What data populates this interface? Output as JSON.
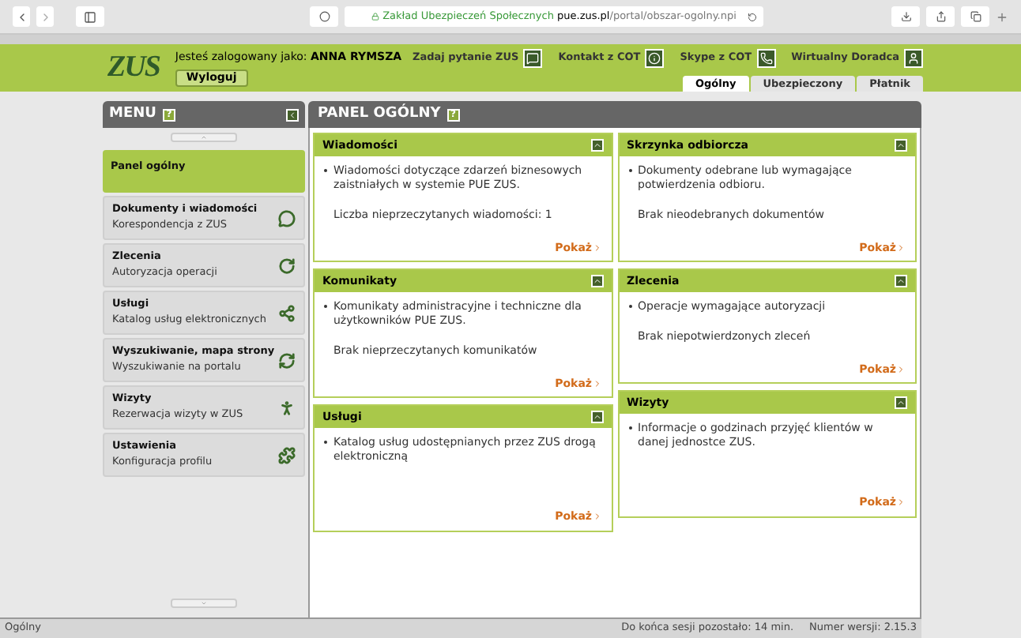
{
  "browser": {
    "url_site": "Zakład Ubezpieczeń Społecznych",
    "url_host": "pue.zus.pl",
    "url_path": "/portal/obszar-ogolny.npi"
  },
  "header": {
    "logo": "ZUS",
    "logged_label": "Jesteś zalogowany jako:",
    "user": "ANNA RYMSZA",
    "logout": "Wyloguj",
    "links": [
      {
        "label": "Zadaj pytanie ZUS",
        "kind": "question"
      },
      {
        "label": "Kontakt z COT",
        "kind": "info"
      },
      {
        "label": "Skype z COT",
        "kind": "skype"
      },
      {
        "label": "Wirtualny Doradca",
        "kind": "advisor"
      }
    ],
    "tabs": [
      {
        "label": "Ogólny",
        "selected": true
      },
      {
        "label": "Ubezpieczony",
        "selected": false
      },
      {
        "label": "Płatnik",
        "selected": false
      }
    ]
  },
  "menu": {
    "title": "MENU",
    "help": "?",
    "items": [
      {
        "title": "Panel ogólny",
        "selected": true,
        "kind": "none"
      },
      {
        "title": "Dokumenty i wiadomości",
        "subtitle": "Korespondencja z ZUS",
        "selected": false,
        "kind": "chat"
      },
      {
        "title": "Zlecenia",
        "subtitle": "Autoryzacja operacji",
        "selected": false,
        "kind": "rotate"
      },
      {
        "title": "Usługi",
        "subtitle": "Katalog usług elektronicznych",
        "selected": false,
        "kind": "network"
      },
      {
        "title": "Wyszukiwanie, mapa strony",
        "subtitle": "Wyszukiwanie na portalu",
        "selected": false,
        "kind": "refresh"
      },
      {
        "title": "Wizyty",
        "subtitle": "Rezerwacja wizyty w ZUS",
        "selected": false,
        "kind": "walk"
      },
      {
        "title": "Ustawienia",
        "subtitle": "Konfiguracja profilu",
        "selected": false,
        "kind": "puzzle"
      }
    ]
  },
  "panel": {
    "title": "PANEL OGÓLNY",
    "help": "?",
    "columns": [
      [
        {
          "title": "Wiadomości",
          "bullet": "Wiadomości dotyczące zdarzeń biznesowych zaistniałych w systemie PUE ZUS.",
          "note": "Liczba nieprzeczytanych wiadomości: 1",
          "link": "Pokaż"
        },
        {
          "title": "Komunikaty",
          "bullet": "Komunikaty administracyjne i techniczne dla użytkowników PUE ZUS.",
          "note": "Brak nieprzeczytanych komunikatów",
          "link": "Pokaż"
        },
        {
          "title": "Usługi",
          "bullet": "Katalog usług udostępnianych przez ZUS drogą elektroniczną",
          "link": "Pokaż"
        }
      ],
      [
        {
          "title": "Skrzynka odbiorcza",
          "bullet": "Dokumenty odebrane lub wymagające potwierdzenia odbioru.",
          "note": "Brak nieodebranych dokumentów",
          "link": "Pokaż"
        },
        {
          "title": "Zlecenia",
          "bullet": "Operacje wymagające autoryzacji",
          "note": "Brak niepotwierdzonych zleceń",
          "link": "Pokaż"
        },
        {
          "title": "Wizyty",
          "bullet": "Informacje o godzinach przyjęć klientów w danej jednostce ZUS.",
          "link": "Pokaż"
        }
      ]
    ]
  },
  "status_bar": {
    "section": "Ogólny",
    "session": "Do końca sesji pozostało: 14 min.",
    "version": "Numer wersji: 2.15.3"
  }
}
